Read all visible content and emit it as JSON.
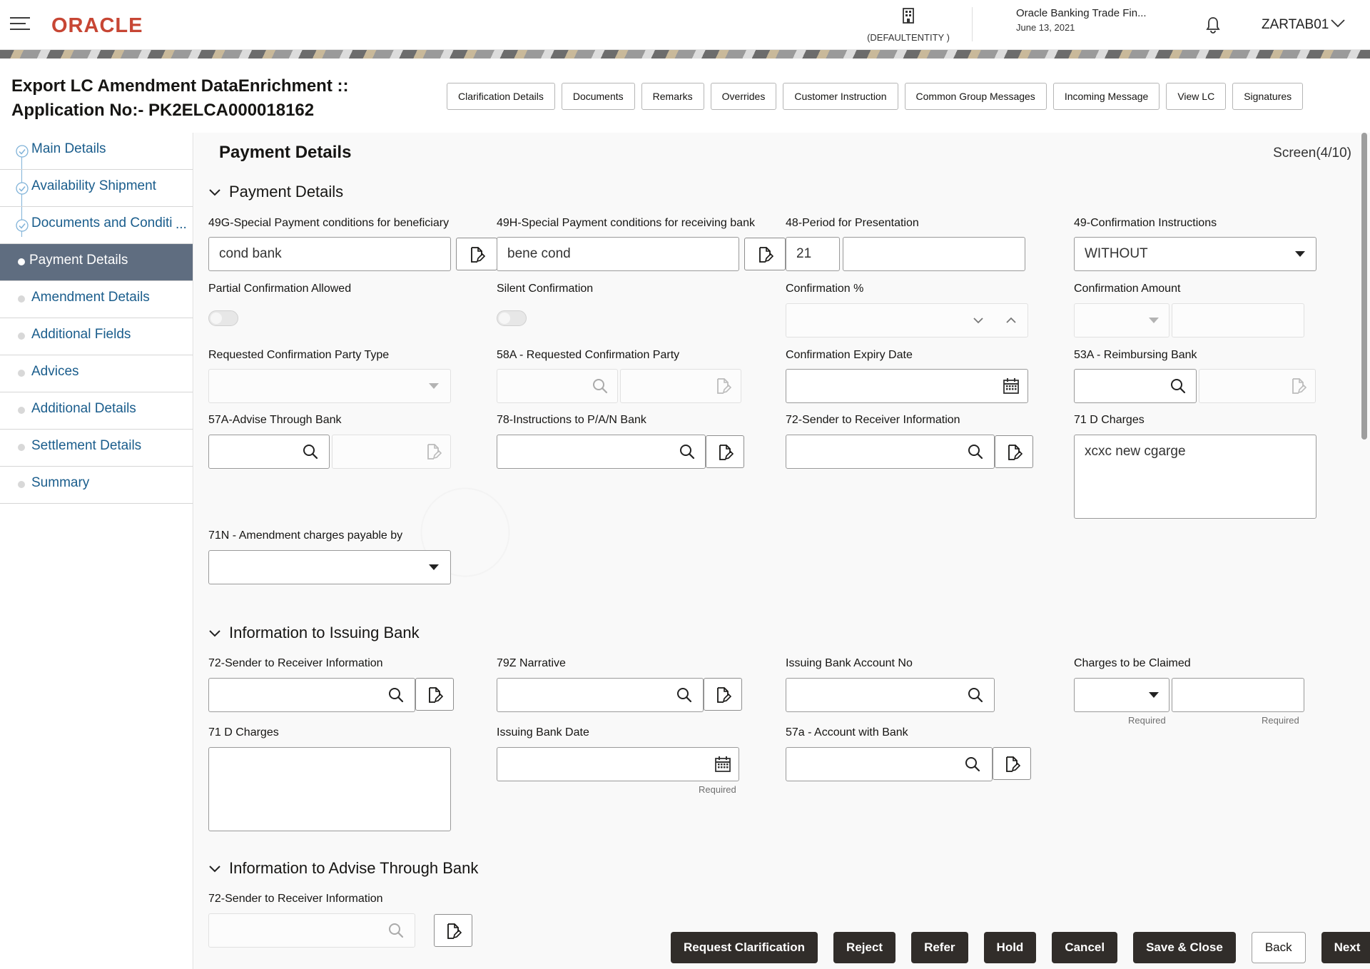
{
  "header": {
    "brand": "ORACLE",
    "entity": "(DEFAULTENTITY )",
    "app_name": "Oracle Banking Trade Fin...",
    "date": "June 13, 2021",
    "user": "ZARTAB01",
    "brand_color": "#c74634"
  },
  "title": {
    "line1": "Export LC Amendment DataEnrichment ::",
    "line2": "Application No:- PK2ELCA000018162"
  },
  "toolbar": [
    "Clarification Details",
    "Documents",
    "Remarks",
    "Overrides",
    "Customer Instruction",
    "Common Group Messages",
    "Incoming Message",
    "View LC",
    "Signatures"
  ],
  "nav": [
    {
      "label": "Main Details",
      "state": "done"
    },
    {
      "label": "Availability Shipment",
      "state": "done"
    },
    {
      "label": "Documents and Conditi",
      "state": "done"
    },
    {
      "label": "Payment Details",
      "state": "active"
    },
    {
      "label": "Amendment Details",
      "state": "pending"
    },
    {
      "label": "Additional Fields",
      "state": "pending"
    },
    {
      "label": "Advices",
      "state": "pending"
    },
    {
      "label": "Additional Details",
      "state": "pending"
    },
    {
      "label": "Settlement Details",
      "state": "pending"
    },
    {
      "label": "Summary",
      "state": "pending"
    }
  ],
  "nav_ellipsis": "...",
  "page": {
    "title": "Payment Details",
    "screen": "Screen(4/10)"
  },
  "payment": {
    "section": "Payment Details",
    "l_49g": "49G-Special Payment conditions for beneficiary",
    "v_49g": "cond bank",
    "l_49h": "49H-Special Payment conditions for receiving bank",
    "v_49h": "bene cond",
    "l_48": "48-Period for Presentation",
    "v_48": "21",
    "l_49": "49-Confirmation Instructions",
    "v_49": "WITHOUT",
    "l_partial": "Partial Confirmation Allowed",
    "l_silent": "Silent Confirmation",
    "l_conf_pct": "Confirmation %",
    "l_conf_amt": "Confirmation Amount",
    "l_req_party_type": "Requested Confirmation Party Type",
    "l_58a": "58A - Requested Confirmation Party",
    "l_conf_exp": "Confirmation Expiry Date",
    "l_53a": "53A - Reimbursing Bank",
    "l_57a": "57A-Advise Through Bank",
    "l_78": "78-Instructions to P/A/N Bank",
    "l_72": "72-Sender to Receiver Information",
    "l_71d": "71 D Charges",
    "v_71d": "xcxc new cgarge",
    "l_71n": "71N - Amendment charges payable by"
  },
  "issuing": {
    "section": "Information to Issuing Bank",
    "l_72": "72-Sender to Receiver Information",
    "l_79z": "79Z Narrative",
    "l_acct": "Issuing Bank Account No",
    "l_charges": "Charges to be Claimed",
    "required": "Required",
    "l_71d": "71 D Charges",
    "l_date": "Issuing Bank Date",
    "l_57a": "57a - Account with Bank"
  },
  "advise": {
    "section": "Information to Advise Through Bank",
    "l_72": "72-Sender to Receiver Information"
  },
  "footer": {
    "request_clarification": "Request Clarification",
    "reject": "Reject",
    "refer": "Refer",
    "hold": "Hold",
    "cancel": "Cancel",
    "save_close": "Save & Close",
    "back": "Back",
    "next": "Next"
  }
}
